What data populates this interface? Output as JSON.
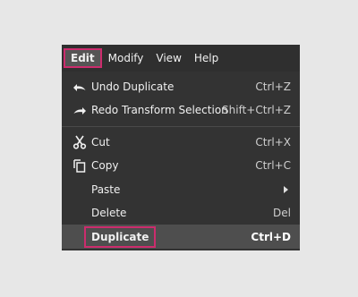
{
  "menubar": {
    "items": [
      {
        "label": "Edit"
      },
      {
        "label": "Modify"
      },
      {
        "label": "View"
      },
      {
        "label": "Help"
      }
    ]
  },
  "edit_menu": {
    "items": [
      {
        "label": "Undo Duplicate",
        "shortcut": "Ctrl+Z",
        "icon": "undo-icon"
      },
      {
        "label": "Redo Transform Selection",
        "shortcut": "Shift+Ctrl+Z",
        "icon": "redo-icon"
      },
      {
        "label": "Cut",
        "shortcut": "Ctrl+X",
        "icon": "scissors-icon"
      },
      {
        "label": "Copy",
        "shortcut": "Ctrl+C",
        "icon": "copy-icon"
      },
      {
        "label": "Paste",
        "shortcut": "",
        "icon": "submenu-arrow"
      },
      {
        "label": "Delete",
        "shortcut": "Del"
      },
      {
        "label": "Duplicate",
        "shortcut": "Ctrl+D"
      }
    ]
  },
  "colors": {
    "highlight_border": "#cc2c6d",
    "menu_background": "#333333"
  }
}
